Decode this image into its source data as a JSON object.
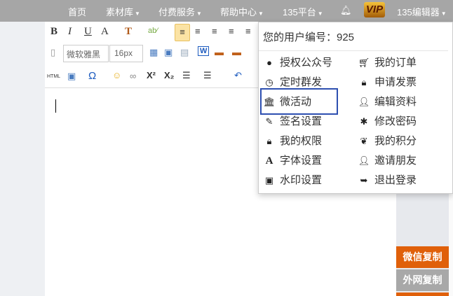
{
  "topnav": [
    {
      "label": "首页",
      "caret": false
    },
    {
      "label": "素材库",
      "caret": true
    },
    {
      "label": "付费服务",
      "caret": true
    },
    {
      "label": "帮助中心",
      "caret": true
    },
    {
      "label": "135平台",
      "caret": true
    }
  ],
  "bell_icon": "bell-icon",
  "vip_label": "VIP",
  "editor_menu": "135编辑器",
  "toolbar": {
    "bold": "B",
    "italic": "I",
    "underline": "U",
    "fontcolor": "A",
    "bgcolor": "T",
    "font_family": "微软雅黑",
    "font_size": "16px",
    "html": "HTML",
    "omega": "Ω",
    "sup": "X²",
    "sub": "X₂"
  },
  "dropdown": {
    "user_id_label": "您的用户编号：925",
    "left": [
      {
        "icon": "wechat-icon",
        "label": "授权公众号"
      },
      {
        "icon": "clock-icon",
        "label": "定时群发"
      },
      {
        "icon": "bank-icon",
        "label": "微活动"
      },
      {
        "icon": "pencil-icon",
        "label": "签名设置"
      },
      {
        "icon": "lock-icon",
        "label": "我的权限"
      },
      {
        "icon": "font-icon",
        "label": "字体设置"
      },
      {
        "icon": "picture-icon",
        "label": "水印设置"
      }
    ],
    "right": [
      {
        "icon": "cart-icon",
        "label": "我的订单"
      },
      {
        "icon": "lock-icon",
        "label": "申请发票"
      },
      {
        "icon": "user-icon",
        "label": "编辑资料"
      },
      {
        "icon": "asterisk-icon",
        "label": "修改密码"
      },
      {
        "icon": "leaf-icon",
        "label": "我的积分"
      },
      {
        "icon": "user-icon",
        "label": "邀请朋友"
      },
      {
        "icon": "logout-icon",
        "label": "退出登录"
      }
    ]
  },
  "side": {
    "wechat_copy": "微信复制",
    "external_copy": "外网复制"
  },
  "colors": {
    "orange": "#e0600a",
    "gray": "#a8a8a8",
    "highlight": "#2d4fb0"
  }
}
